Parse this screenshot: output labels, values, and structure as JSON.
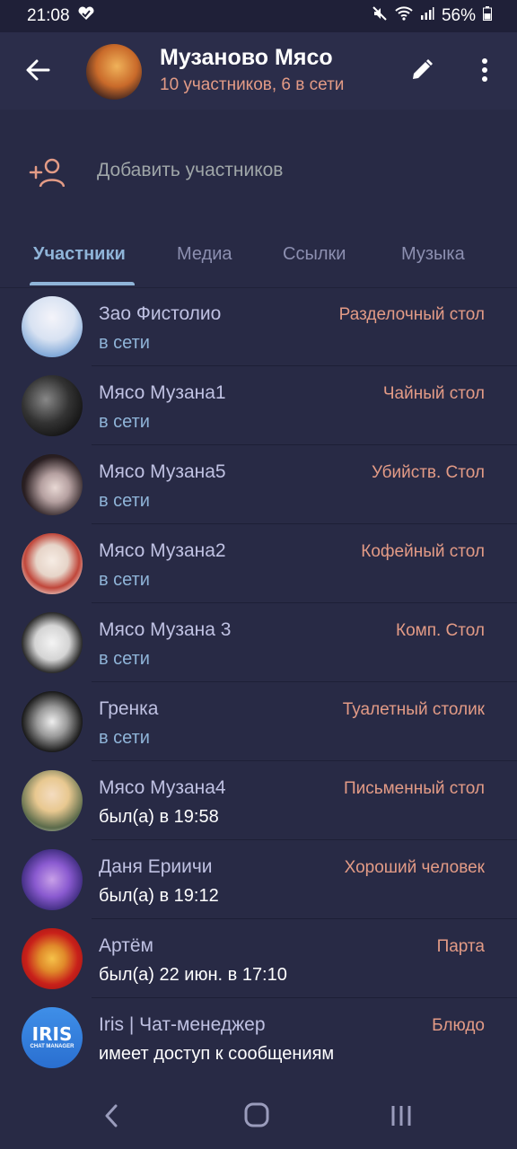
{
  "status_bar": {
    "time": "21:08",
    "battery": "56%",
    "icons": [
      "heart-check-icon",
      "mute-icon",
      "wifi-icon",
      "signal-icon",
      "battery-icon"
    ]
  },
  "header": {
    "title": "Музаново Мясо",
    "subtitle": "10 участников, 6 в сети",
    "icons": [
      "back-arrow-icon",
      "pencil-icon",
      "more-vertical-icon"
    ]
  },
  "add_members": {
    "label": "Добавить участников",
    "icon": "add-user-icon"
  },
  "tabs": [
    {
      "label": "Участники",
      "active": true
    },
    {
      "label": "Медиа",
      "active": false
    },
    {
      "label": "Ссылки",
      "active": false
    },
    {
      "label": "Музыка",
      "active": false
    }
  ],
  "members": [
    {
      "name": "Зао Фистолио",
      "status": "в сети",
      "online": true,
      "role": "Разделочный стол"
    },
    {
      "name": "Мясо Музана1",
      "status": "в сети",
      "online": true,
      "role": "Чайный стол"
    },
    {
      "name": "Мясо Музана5",
      "status": "в сети",
      "online": true,
      "role": "Убийств. Стол"
    },
    {
      "name": "Мясо Музана2",
      "status": "в сети",
      "online": true,
      "role": "Кофейный стол"
    },
    {
      "name": "Мясо Музана 3",
      "status": "в сети",
      "online": true,
      "role": "Комп. Стол"
    },
    {
      "name": "Гренка",
      "status": "в сети",
      "online": true,
      "role": "Туалетный столик"
    },
    {
      "name": "Мясо Музана4",
      "status": "был(а) в 19:58",
      "online": false,
      "role": "Письменный стол"
    },
    {
      "name": "Даня Ериичи",
      "status": "был(а) в 19:12",
      "online": false,
      "role": "Хороший человек"
    },
    {
      "name": "Артём",
      "status": "был(а) 22 июн. в 17:10",
      "online": false,
      "role": "Парта"
    },
    {
      "name": "Iris | Чат-менеджер",
      "status": "имеет доступ к сообщениям",
      "online": false,
      "role": "Блюдо"
    }
  ],
  "iris_avatar": {
    "line1": "IRIS",
    "line2": "CHAT MANAGER"
  },
  "colors": {
    "background": "#282a45",
    "accent": "#8fb4d8",
    "role": "#e39b86"
  }
}
